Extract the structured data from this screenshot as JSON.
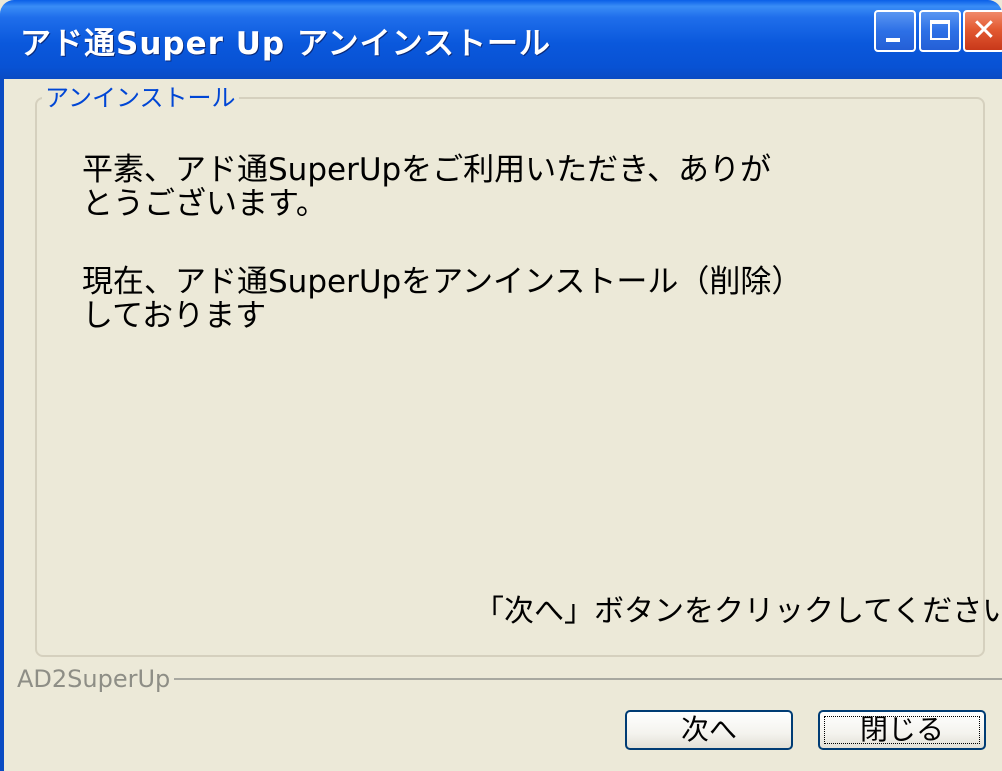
{
  "window": {
    "title": "アド通Super Up アンインストール",
    "controls": {
      "minimize_icon": "minimize-icon",
      "maximize_icon": "maximize-icon",
      "close_icon": "close-icon",
      "close_glyph": "✕"
    }
  },
  "group": {
    "legend": "アンインストール",
    "paragraph1": "平素、アド通SuperUpをご利用いただき、ありがとうございます。",
    "paragraph2": "現在、アド通SuperUpをアンインストール（削除）しております",
    "hint": "「次へ」ボタンをクリックしてください。"
  },
  "footer": {
    "label": "AD2SuperUp",
    "next_button": "次へ",
    "close_button": "閉じる"
  },
  "colors": {
    "titlebar": "#0A58DC",
    "background": "#ECE9D8",
    "legend_text": "#0046D5",
    "close_button": "#E35A32"
  }
}
